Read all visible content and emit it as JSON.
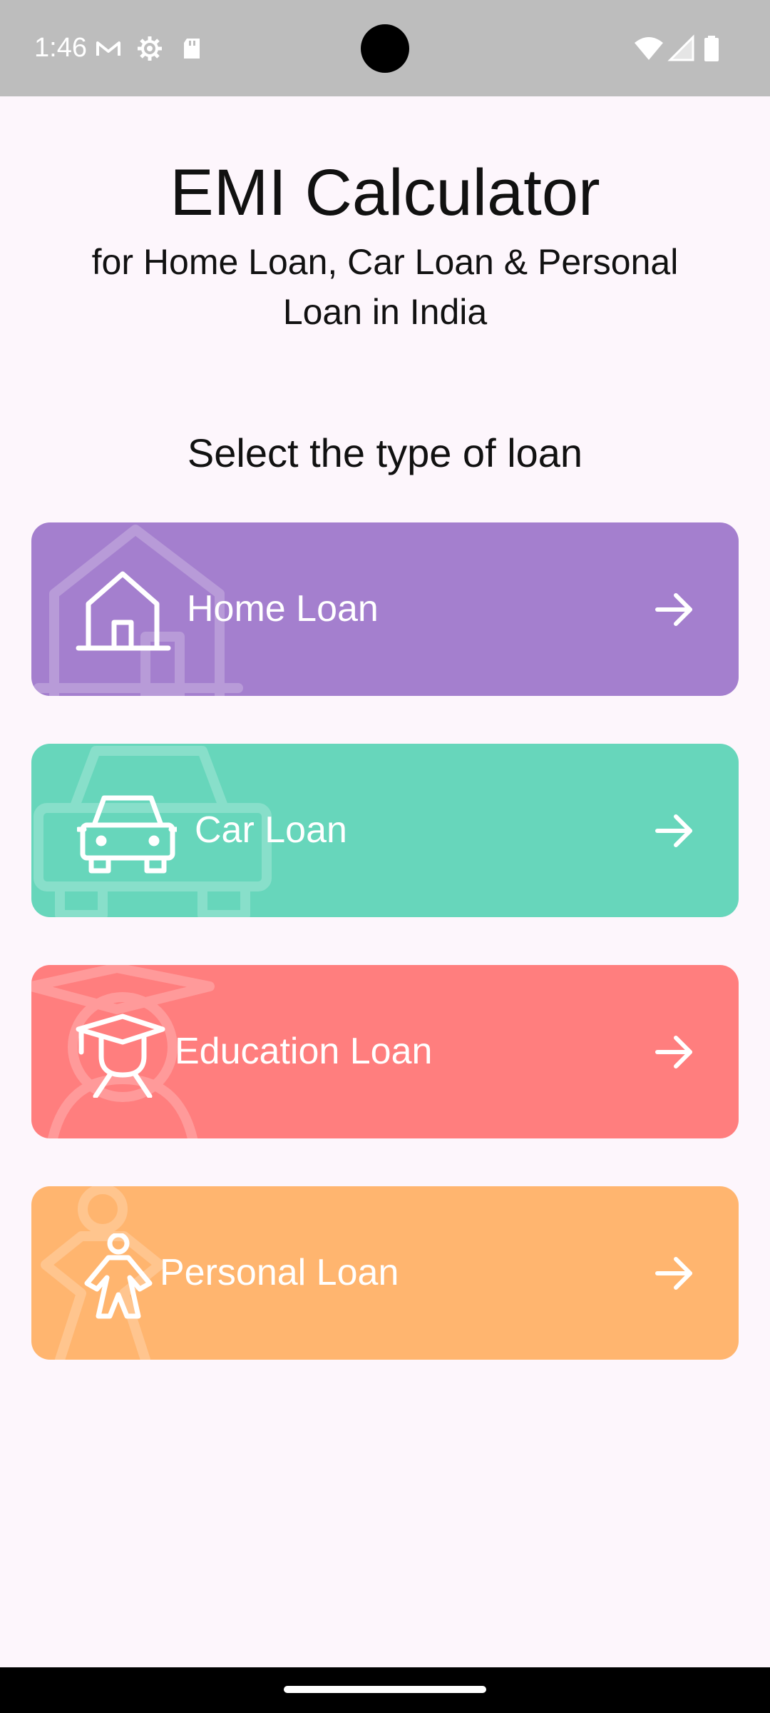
{
  "status_bar": {
    "time": "1:46",
    "left_icons": [
      "gmail-icon",
      "settings-icon",
      "sd-card-icon"
    ],
    "right_icons": [
      "wifi-icon",
      "signal-icon",
      "battery-icon"
    ]
  },
  "header": {
    "title": "EMI Calculator",
    "subtitle": "for Home Loan, Car Loan & Personal Loan in India"
  },
  "section": {
    "heading": "Select the type of loan"
  },
  "loans": [
    {
      "label": "Home Loan",
      "icon": "house-icon",
      "color": "#a47fce"
    },
    {
      "label": "Car Loan",
      "icon": "car-icon",
      "color": "#67d6bb"
    },
    {
      "label": "Education Loan",
      "icon": "graduate-icon",
      "color": "#ff7e7e"
    },
    {
      "label": "Personal Loan",
      "icon": "person-icon",
      "color": "#ffb56f"
    }
  ],
  "colors": {
    "background": "#fdf6fc",
    "status_bar": "#bdbdbd",
    "text": "#111111"
  }
}
